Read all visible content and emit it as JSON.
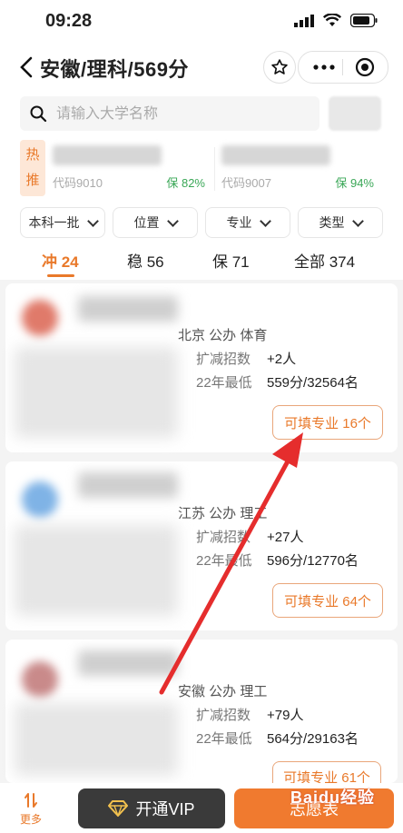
{
  "status": {
    "time": "09:28"
  },
  "nav": {
    "title": "安徽/理科/569分"
  },
  "search": {
    "placeholder": "请输入大学名称"
  },
  "hot": {
    "tag_line1": "热",
    "tag_line2": "推",
    "cards": [
      {
        "code": "代码9010",
        "prob": "保 82%"
      },
      {
        "code": "代码9007",
        "prob": "保 94%"
      }
    ]
  },
  "filters": [
    {
      "label": "本科一批"
    },
    {
      "label": "位置"
    },
    {
      "label": "专业"
    },
    {
      "label": "类型"
    }
  ],
  "tabs": [
    {
      "label": "冲 24"
    },
    {
      "label": "稳 56"
    },
    {
      "label": "保 71"
    },
    {
      "label": "全部 374"
    }
  ],
  "schools": [
    {
      "tags": "北京 公办 体育",
      "expand_label": "扩减招数",
      "expand_value": "+2人",
      "min_label": "22年最低",
      "min_value": "559分/32564名",
      "button": "可填专业 16个"
    },
    {
      "tags": "江苏 公办 理工",
      "expand_label": "扩减招数",
      "expand_value": "+27人",
      "min_label": "22年最低",
      "min_value": "596分/12770名",
      "button": "可填专业 64个"
    },
    {
      "tags": "安徽 公办 理工",
      "expand_label": "扩减招数",
      "expand_value": "+79人",
      "min_label": "22年最低",
      "min_value": "564分/29163名",
      "button": "可填专业 61个"
    }
  ],
  "bottom": {
    "more": "更多",
    "vip": "开通VIP",
    "volunteer": "志愿表",
    "watermark": "Baidu经验"
  },
  "colors": {
    "accent": "#e9792a",
    "arrow": "#e52d2d",
    "safe": "#3aa757"
  }
}
